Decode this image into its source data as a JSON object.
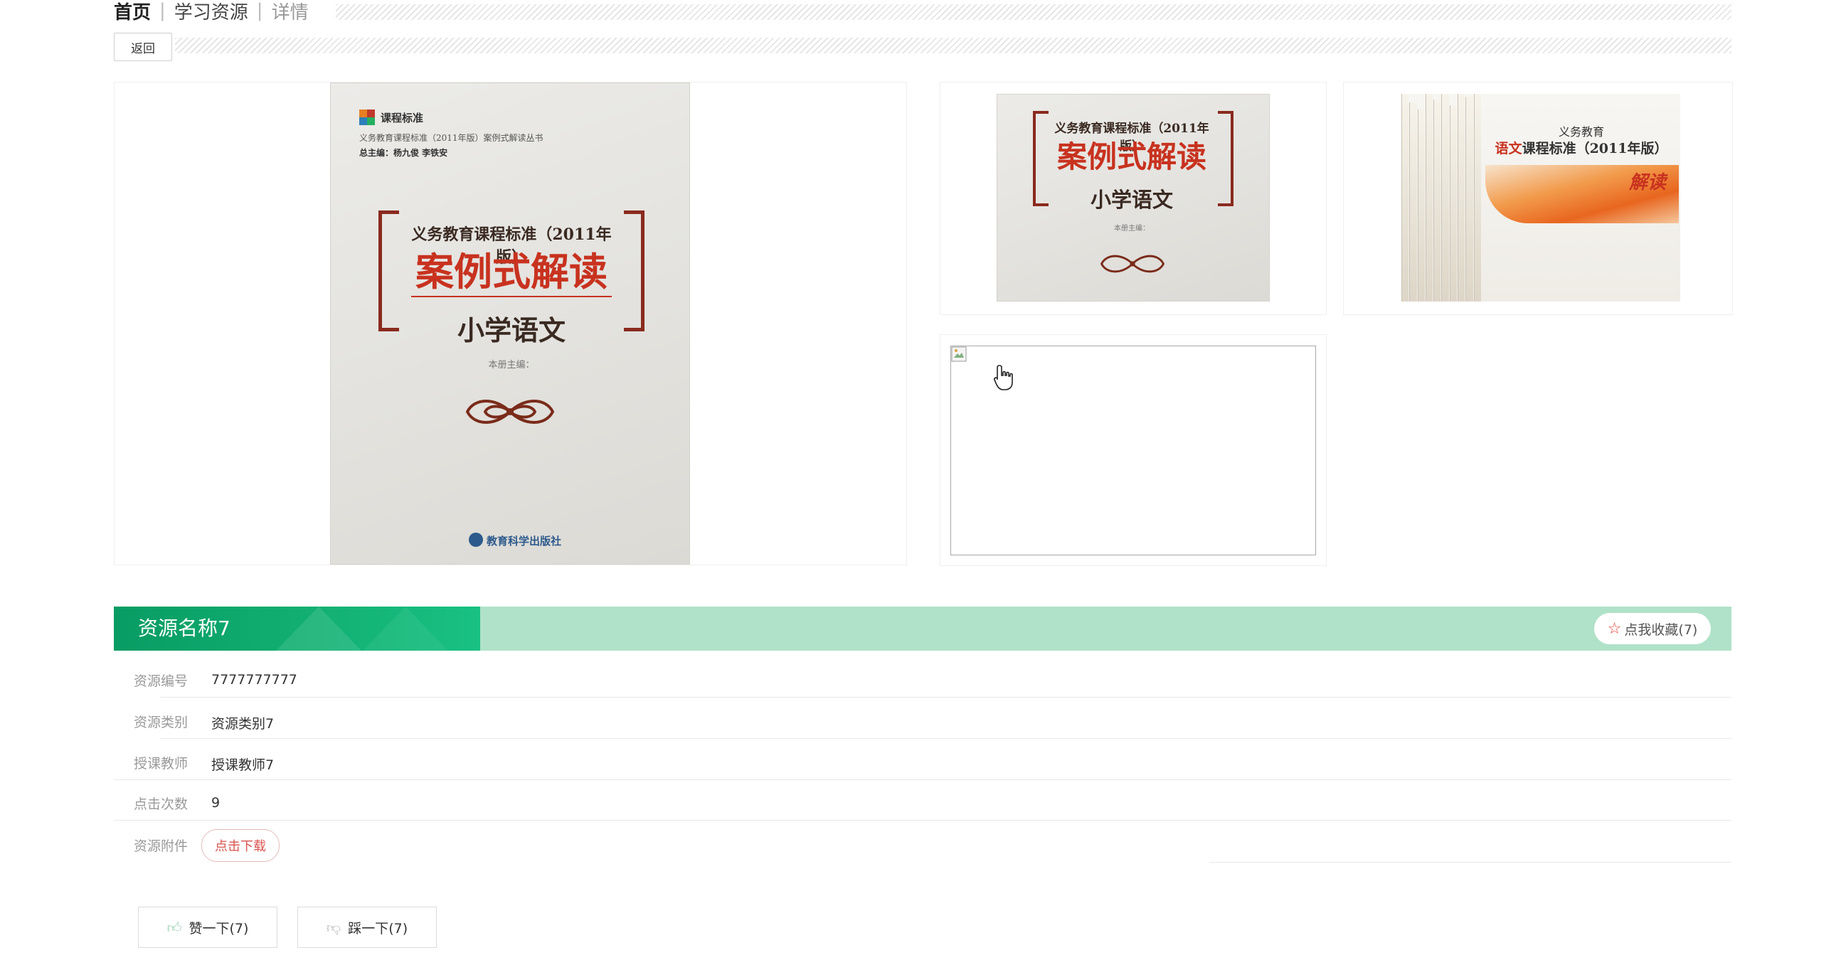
{
  "breadcrumb": {
    "home": "首页",
    "resources": "学习资源",
    "current": "详情",
    "separator": "|"
  },
  "back_button": "返回",
  "main_image": {
    "series_name": "课程标准",
    "series_line": "义务教育课程标准（2011年版）案例式解读丛书",
    "chief_editors": "总主编：杨九俊  李铁安",
    "title_line": "义务教育课程标准（2011年版）",
    "big_title": "案例式解读",
    "subject": "小学语文",
    "editor": "本册主编：",
    "publisher": "教育科学出版社"
  },
  "thumb1": {
    "title_line": "义务教育课程标准（2011年版）",
    "big_title": "案例式解读",
    "subject": "小学语文",
    "editor": "本册主编："
  },
  "thumb2": {
    "header": "义务教育",
    "title_accent": "语文",
    "title_rest": "课程标准（2011年版）",
    "word": "解读"
  },
  "resource": {
    "title": "资源名称7",
    "favorite_label": "点我收藏(7)"
  },
  "details": [
    {
      "label": "资源编号",
      "value": "7777777777"
    },
    {
      "label": "资源类别",
      "value": "资源类别7"
    },
    {
      "label": "授课教师",
      "value": "授课教师7"
    },
    {
      "label": "点击次数",
      "value": "9"
    },
    {
      "label": "资源附件",
      "value": ""
    }
  ],
  "download_label": "点击下载",
  "like_label": "赞一下(7)",
  "dislike_label": "踩一下(7)",
  "colors": {
    "title_bar_dark": "#12b072",
    "title_bar_light": "#b0e2c9",
    "accent_red": "#d9534f",
    "cover_red": "#c8321f"
  },
  "icons": [
    "star-icon",
    "thumbs-up-icon",
    "thumbs-down-icon",
    "broken-image-icon",
    "hand-cursor-icon"
  ]
}
